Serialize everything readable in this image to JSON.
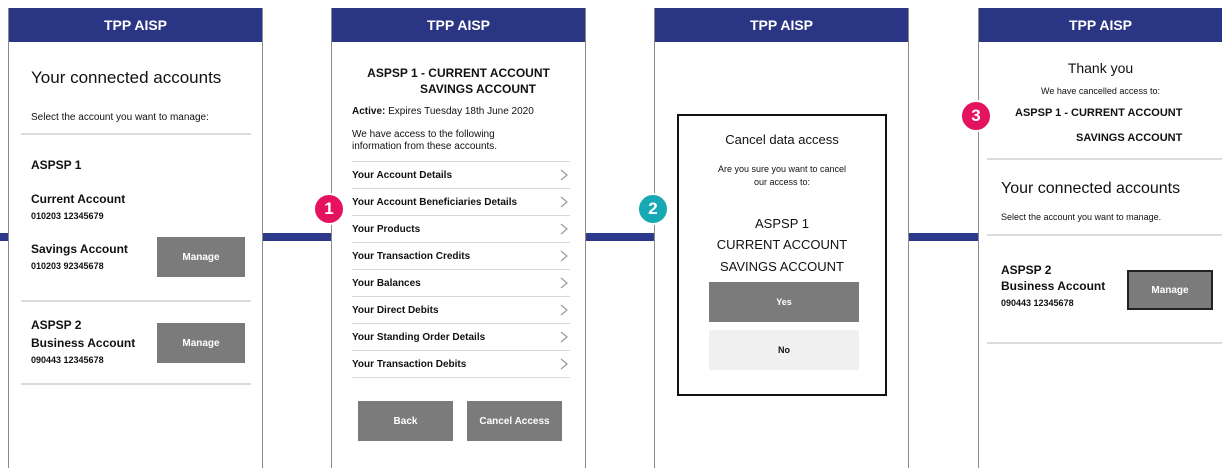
{
  "header_title": "TPP AISP",
  "screen1": {
    "title": "Your connected accounts",
    "instruction": "Select the account you want to manage:",
    "bank1": "ASPSP 1",
    "acct1_name": "Current Account",
    "acct1_number": "010203  12345679",
    "acct2_name": "Savings Account",
    "acct2_number": "010203  92345678",
    "manage_label": "Manage",
    "bank2": "ASPSP 2",
    "acct3_name": "Business Account",
    "acct3_number": "090443  12345678"
  },
  "screen2": {
    "title_line1": "ASPSP 1 - CURRENT ACCOUNT",
    "title_line2": "SAVINGS ACCOUNT",
    "active_label": "Active:",
    "active_value": " Expires Tuesday 18th June 2020",
    "access_line1": "We have access to the following",
    "access_line2": "information from these accounts.",
    "items": [
      "Your Account Details",
      "Your Account Beneficiaries Details",
      "Your Products",
      "Your Transaction Credits",
      "Your Balances",
      "Your Direct Debits",
      "Your Standing Order Details",
      "Your Transaction Debits"
    ],
    "back_label": "Back",
    "cancel_label": "Cancel Access",
    "badge": "1"
  },
  "screen3": {
    "dialog_title": "Cancel data access",
    "question_line1": "Are you sure you want to cancel",
    "question_line2": "our access to:",
    "bank": "ASPSP 1",
    "acct_line1": "CURRENT ACCOUNT",
    "acct_line2": "SAVINGS ACCOUNT",
    "yes_label": "Yes",
    "no_label": "No",
    "badge": "2"
  },
  "screen4": {
    "thanks": "Thank you",
    "cancelled_text": "We have cancelled access to:",
    "cancelled_line1": "ASPSP 1 - CURRENT ACCOUNT",
    "cancelled_line2": "SAVINGS ACCOUNT",
    "title": "Your connected accounts",
    "instruction": "Select the account you want to manage.",
    "bank": "ASPSP 2",
    "acct_name": "Business Account",
    "acct_number": "090443  12345678",
    "manage_label": "Manage",
    "badge": "3"
  },
  "colors": {
    "header": "#2a3584",
    "badge_pink": "#e5125f",
    "badge_teal": "#17a9b3",
    "button_gray": "#7b7b7b"
  }
}
